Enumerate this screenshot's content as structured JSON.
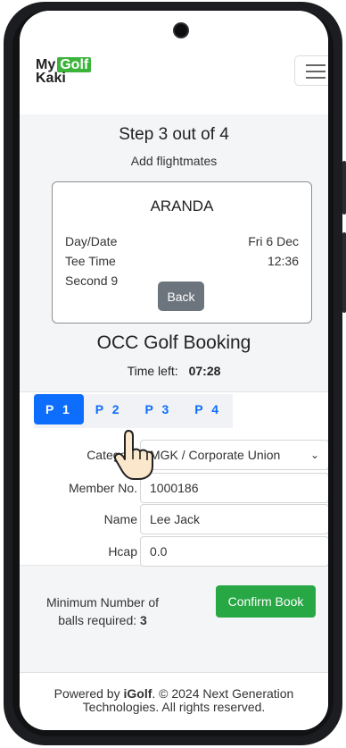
{
  "brand": {
    "word1": "My",
    "word2": "Golf",
    "word3": "Kaki"
  },
  "header": {
    "menu_icon": "hamburger-icon"
  },
  "step": {
    "title": "Step 3 out of 4",
    "subtitle": "Add flightmates"
  },
  "course_card": {
    "club": "ARANDA",
    "rows": [
      {
        "label": "Day/Date",
        "value": "Fri 6 Dec"
      },
      {
        "label": "Tee Time",
        "value": "12:36"
      },
      {
        "label": "Second 9",
        "value": ""
      }
    ],
    "back_label": "Back"
  },
  "booking": {
    "title": "OCC Golf Booking",
    "time_left_label": "Time left:",
    "time_left_value": "07:28"
  },
  "player_tabs": [
    "P 1",
    "P 2",
    "P 3",
    "P 4"
  ],
  "active_tab": "P 1",
  "form": {
    "category": {
      "label": "Category",
      "value": "MGK / Corporate Union"
    },
    "member_no": {
      "label": "Member No.",
      "value": "1000186"
    },
    "name": {
      "label": "Name",
      "value": "Lee Jack"
    },
    "hcap": {
      "label": "Hcap",
      "value": "0.0"
    }
  },
  "min_balls": {
    "text": "Minimum Number of balls required:",
    "value": "3"
  },
  "confirm_label": "Confirm Book",
  "footer": {
    "powered": "Powered by",
    "brand": "iGolf",
    "rest": ". © 2024 Next Generation Technologies. All rights reserved."
  },
  "colors": {
    "primary": "#0d6efd",
    "success": "#28a745",
    "secondary": "#6c757d",
    "logo_green": "#3cb43c"
  }
}
